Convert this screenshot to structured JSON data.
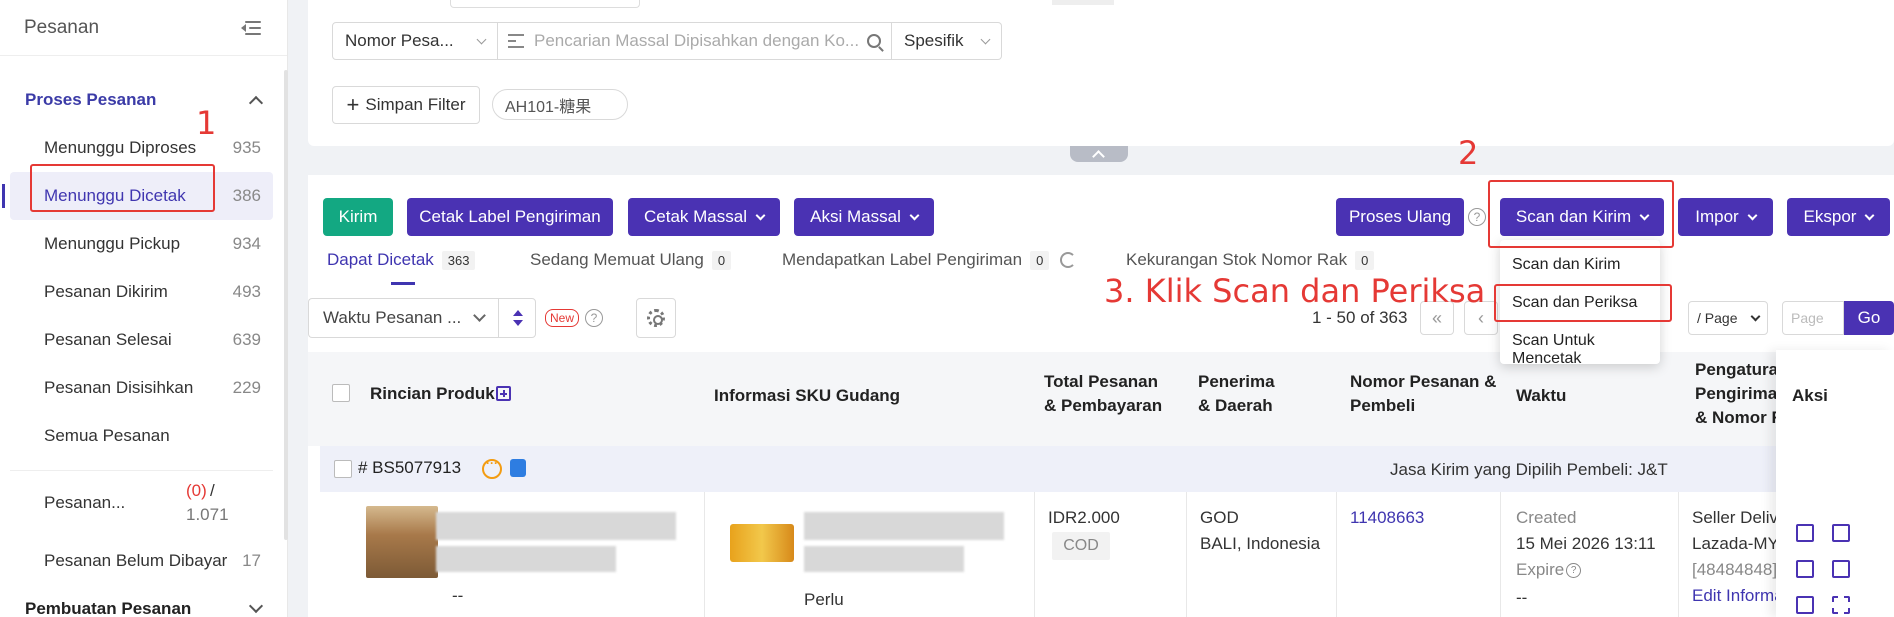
{
  "sidebar": {
    "title": "Pesanan",
    "section_title": "Proses Pesanan",
    "items": [
      {
        "label": "Menunggu Diproses",
        "count": "935"
      },
      {
        "label": "Menunggu Dicetak",
        "count": "386"
      },
      {
        "label": "Menunggu Pickup",
        "count": "934"
      },
      {
        "label": "Pesanan Dikirim",
        "count": "493"
      },
      {
        "label": "Pesanan Selesai",
        "count": "639"
      },
      {
        "label": "Pesanan Disisihkan",
        "count": "229"
      },
      {
        "label": "Semua Pesanan",
        "count": ""
      }
    ],
    "extra_item": {
      "label": "Pesanan...",
      "red_count": "(0)",
      "slash": "/",
      "total": "1.071"
    },
    "unpaid": {
      "label": "Pesanan Belum Dibayar",
      "count": "17"
    },
    "bottom_section": "Pembuatan Pesanan"
  },
  "filter": {
    "field_select": "Nomor Pesa...",
    "search_placeholder": "Pencarian Massal Dipisahkan dengan Ko...",
    "match_select": "Spesifik",
    "save_filter_label": "Simpan Filter",
    "save_filter_plus": "+",
    "tag": "AH101-糖果"
  },
  "toolbar": {
    "kirim": "Kirim",
    "cetak_label": "Cetak Label Pengiriman",
    "cetak_massal": "Cetak Massal",
    "aksi_massal": "Aksi Massal",
    "proses_ulang": "Proses Ulang",
    "help": "?",
    "scan_kirim": "Scan dan Kirim",
    "impor": "Impor",
    "ekspor": "Ekspor"
  },
  "dropdown": {
    "items": [
      "Scan dan Kirim",
      "Scan dan Periksa",
      "Scan Untuk Mencetak"
    ]
  },
  "tabs": [
    {
      "label": "Dapat Dicetak",
      "count": "363"
    },
    {
      "label": "Sedang Memuat Ulang",
      "count": "0"
    },
    {
      "label": "Mendapatkan Label Pengiriman",
      "count": "0"
    },
    {
      "label": "Kekurangan Stok Nomor Rak",
      "count": "0"
    }
  ],
  "list_controls": {
    "sort_select": "Waktu Pesanan ...",
    "new_badge": "New",
    "help": "?",
    "range": "1 - 50 of 363",
    "first_page": "«",
    "prev_page": "‹",
    "per_page": "/ Page",
    "page_placeholder": "Page",
    "go": "Go"
  },
  "table": {
    "headers": {
      "product": "Rincian Produk",
      "sku": "Informasi SKU Gudang",
      "total_1": "Total Pesanan",
      "total_2": "& Pembayaran",
      "receiver_1": "Penerima",
      "receiver_2": "& Daerah",
      "order_no_1": "Nomor Pesanan &",
      "order_no_2": "Pembeli",
      "time": "Waktu",
      "shipping_1": "Pengaturan",
      "shipping_2": "Pengiriman",
      "shipping_3": "& Nomor R",
      "action": "Aksi"
    },
    "group": {
      "order_id": "# BS5077913",
      "carrier": "Jasa Kirim yang Dipilih Pembeli: J&T"
    },
    "row": {
      "product_dash": "--",
      "sku_note": "Perlu",
      "total": "IDR2.000",
      "payment": "COD",
      "receiver": "GOD",
      "region": "BALI, Indonesia",
      "order_no": "11408663",
      "created_label": "Created",
      "created": "15 Mei 2026 13:11",
      "expire_label": "Expire",
      "expire_help": "?",
      "expire_value": "--",
      "ship_1": "Seller Delive",
      "ship_2": "Lazada-MY-",
      "ship_3": "[48484848]",
      "ship_4": "Edit Informa"
    }
  },
  "annotations": {
    "step1": "1",
    "step2": "2",
    "step3": "3. Klik Scan dan Periksa"
  },
  "colors": {
    "primary": "#4a32b3",
    "green": "#13a882",
    "annotation": "#e53935"
  }
}
